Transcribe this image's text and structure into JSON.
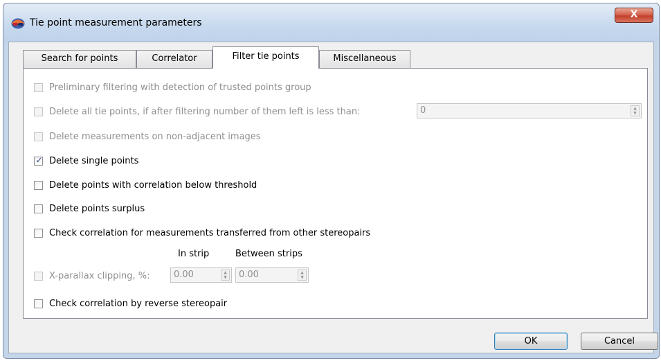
{
  "window": {
    "title": "Tie point measurement parameters",
    "close_label": "X"
  },
  "tabs": [
    {
      "label": "Search for points",
      "active": false
    },
    {
      "label": "Correlator",
      "active": false
    },
    {
      "label": "Filter tie points",
      "active": true
    },
    {
      "label": "Miscellaneous",
      "active": false
    }
  ],
  "filter": {
    "preliminary": {
      "label": "Preliminary filtering with detection of trusted points group",
      "checked": false,
      "enabled": false
    },
    "delete_all": {
      "label": "Delete all tie points, if after filtering number of them left is less than:",
      "checked": false,
      "enabled": false,
      "value": "0"
    },
    "non_adjacent": {
      "label": "Delete measurements on non-adjacent images",
      "checked": false,
      "enabled": false
    },
    "single": {
      "label": "Delete single points",
      "checked": true,
      "enabled": true
    },
    "low_corr": {
      "label": "Delete points with correlation below threshold",
      "checked": false,
      "enabled": true
    },
    "surplus": {
      "label": "Delete points surplus",
      "checked": false,
      "enabled": true
    },
    "transferred": {
      "label": "Check correlation for measurements transferred from other stereopairs",
      "checked": false,
      "enabled": true
    },
    "xparallax": {
      "label": "X-parallax clipping, %:",
      "checked": false,
      "enabled": false,
      "in_strip_header": "In strip",
      "between_strips_header": "Between strips",
      "in_strip_value": "0.00",
      "between_strips_value": "0.00"
    },
    "reverse": {
      "label": "Check correlation by reverse stereopair",
      "checked": false,
      "enabled": true
    }
  },
  "buttons": {
    "ok": "OK",
    "cancel": "Cancel"
  }
}
